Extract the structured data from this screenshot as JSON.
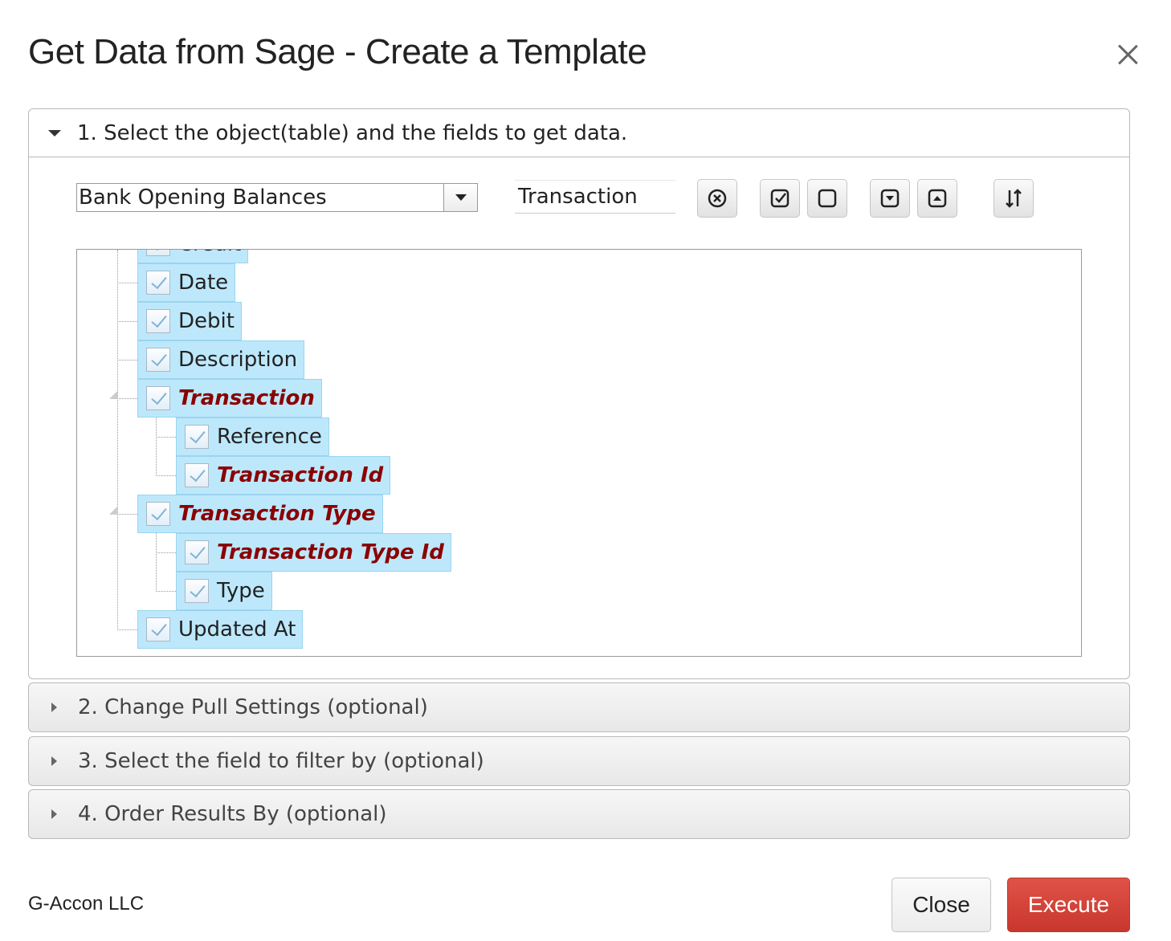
{
  "dialog": {
    "title": "Get Data from Sage - Create a Template"
  },
  "sections": [
    {
      "label": "1. Select the object(table) and the fields to get data.",
      "expanded": true
    },
    {
      "label": "2. Change Pull Settings (optional)",
      "expanded": false
    },
    {
      "label": "3. Select the field to filter by (optional)",
      "expanded": false
    },
    {
      "label": "4. Order Results By (optional)",
      "expanded": false
    }
  ],
  "toolbar": {
    "object_select_value": "Bank Opening Balances",
    "search_value": "Transaction",
    "buttons": [
      {
        "icon": "clear-search-icon"
      },
      {
        "icon": "check-all-icon"
      },
      {
        "icon": "uncheck-all-icon"
      },
      {
        "icon": "expand-all-icon"
      },
      {
        "icon": "collapse-all-icon"
      },
      {
        "icon": "sort-icon"
      }
    ]
  },
  "tree": {
    "items": [
      {
        "label": "Credit",
        "level": 1,
        "checked": true,
        "match": false
      },
      {
        "label": "Date",
        "level": 1,
        "checked": true,
        "match": false
      },
      {
        "label": "Debit",
        "level": 1,
        "checked": true,
        "match": false
      },
      {
        "label": "Description",
        "level": 1,
        "checked": true,
        "match": false
      },
      {
        "label": "Transaction",
        "level": 1,
        "checked": true,
        "match": true,
        "expanded": true
      },
      {
        "label": "Reference",
        "level": 2,
        "checked": true,
        "match": false
      },
      {
        "label": "Transaction Id",
        "level": 2,
        "checked": true,
        "match": true
      },
      {
        "label": "Transaction Type",
        "level": 1,
        "checked": true,
        "match": true,
        "expanded": true
      },
      {
        "label": "Transaction Type Id",
        "level": 2,
        "checked": true,
        "match": true
      },
      {
        "label": "Type",
        "level": 2,
        "checked": true,
        "match": false
      },
      {
        "label": "Updated At",
        "level": 1,
        "checked": true,
        "match": false
      }
    ]
  },
  "footer": {
    "brand": "G-Accon LLC",
    "close_label": "Close",
    "execute_label": "Execute"
  },
  "colors": {
    "match_text": "#8b0000",
    "node_bg": "#bde8fb",
    "execute_bg": "#d5443a"
  }
}
